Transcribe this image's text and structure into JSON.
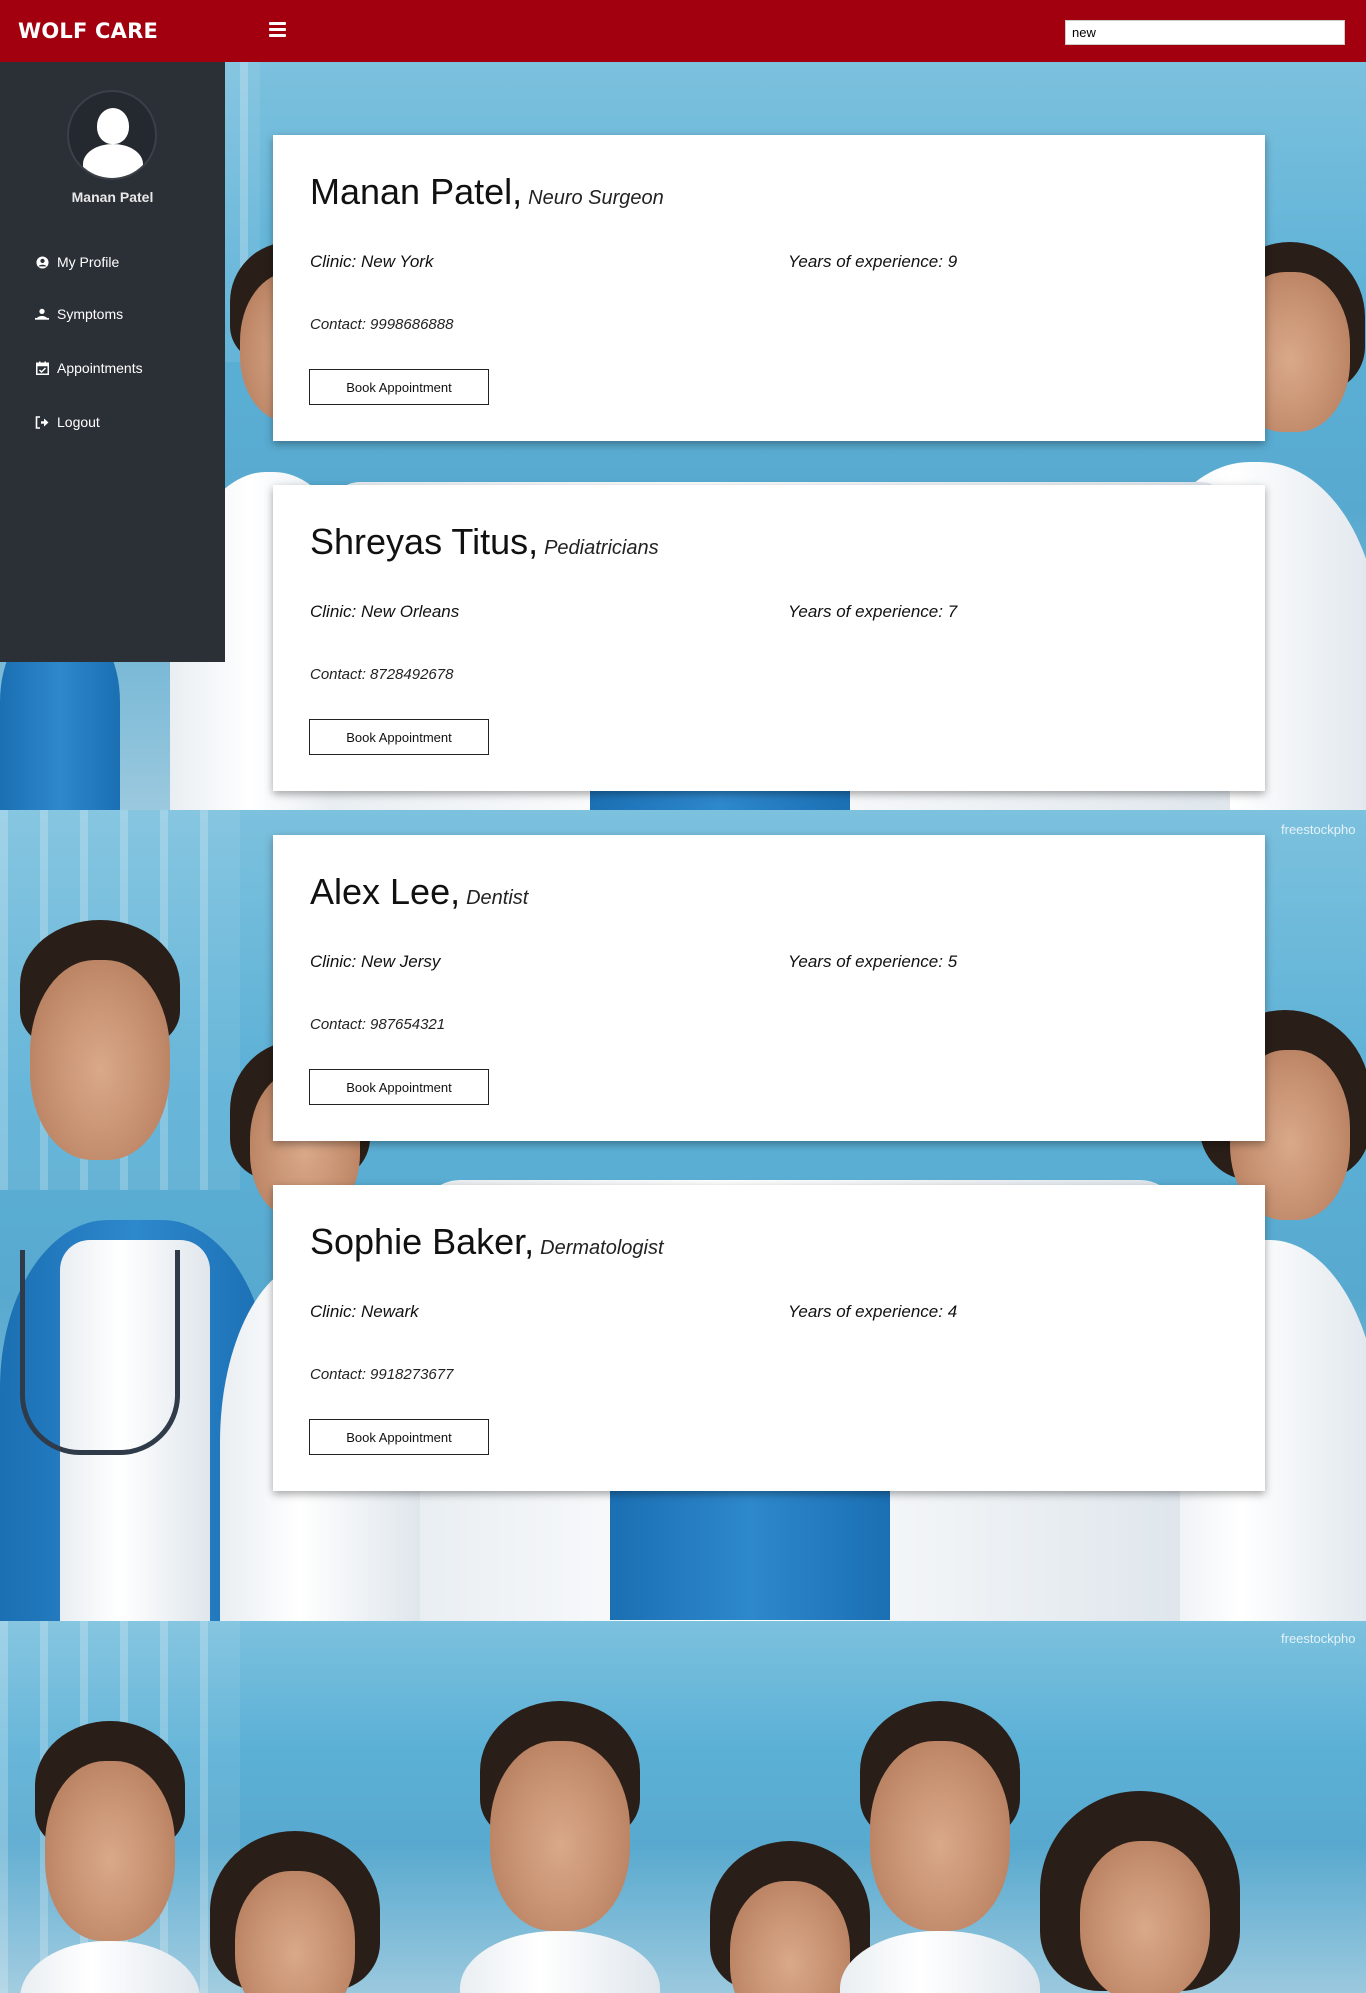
{
  "topbar": {
    "brand": "WOLF CARE",
    "menu_icon": "hamburger-menu-icon",
    "search_value": "new",
    "background_color": "#a3000f"
  },
  "sidebar": {
    "background_color": "#2b2f36",
    "avatar_icon": "user-avatar-icon",
    "username": "Manan Patel",
    "items": [
      {
        "label": "My Profile",
        "icon": "user-circle-icon"
      },
      {
        "label": "Symptoms",
        "icon": "user-md-icon"
      },
      {
        "label": "Appointments",
        "icon": "calendar-check-icon"
      },
      {
        "label": "Logout",
        "icon": "sign-out-icon"
      }
    ]
  },
  "doctors": [
    {
      "name": "Manan Patel,",
      "specialty": "Neuro Surgeon",
      "clinic": "Clinic: New York",
      "experience": "Years of experience: 9",
      "contact": "Contact: 9998686888",
      "button": "Book Appointment"
    },
    {
      "name": "Shreyas Titus,",
      "specialty": "Pediatricians",
      "clinic": "Clinic: New Orleans",
      "experience": "Years of experience: 7",
      "contact": "Contact: 8728492678",
      "button": "Book Appointment"
    },
    {
      "name": "Alex Lee,",
      "specialty": "Dentist",
      "clinic": "Clinic: New Jersy",
      "experience": "Years of experience: 5",
      "contact": "Contact: 987654321",
      "button": "Book Appointment"
    },
    {
      "name": "Sophie Baker,",
      "specialty": "Dermatologist",
      "clinic": "Clinic: Newark",
      "experience": "Years of experience: 4",
      "contact": "Contact: 9918273677",
      "button": "Book Appointment"
    }
  ],
  "background": {
    "watermark": "freestockpho"
  }
}
